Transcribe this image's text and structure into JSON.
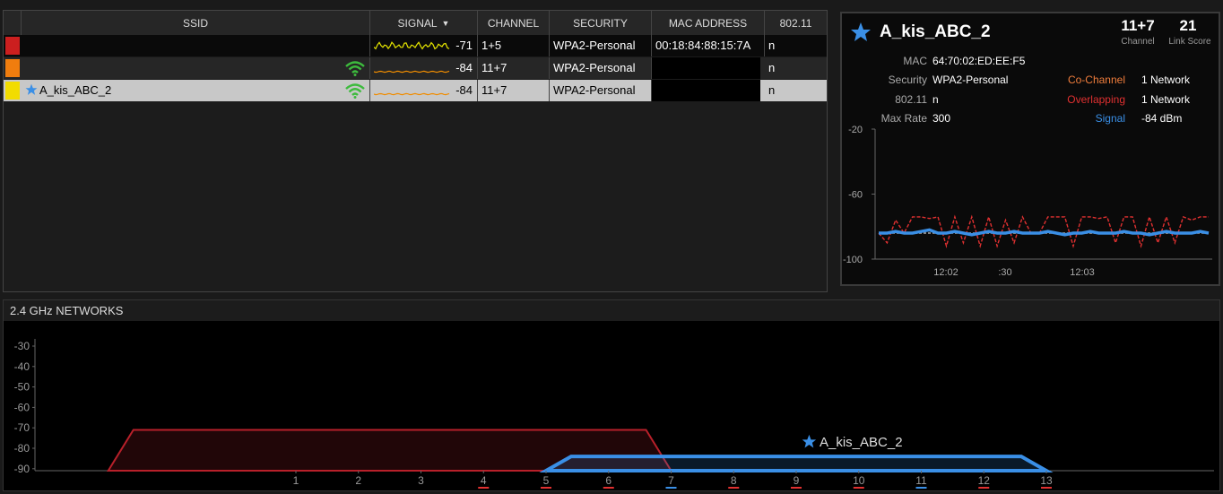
{
  "table": {
    "headers": [
      "SSID",
      "SIGNAL",
      "CHANNEL",
      "SECURITY",
      "MAC ADDRESS",
      "802.11"
    ],
    "rows": [
      {
        "color": "#cc1f1f",
        "ssid": "",
        "signal": "-71",
        "channel": "1+5",
        "security": "WPA2-Personal",
        "mac": "00:18:84:88:15:7A",
        "mode": "n",
        "spark_color": "#e6e600",
        "selected": false,
        "starred": false,
        "wifi_icon": false
      },
      {
        "color": "#f07d0e",
        "ssid": "",
        "signal": "-84",
        "channel": "11+7",
        "security": "WPA2-Personal",
        "mac": "",
        "mode": "n",
        "spark_color": "#f08c00",
        "selected": false,
        "starred": false,
        "wifi_icon": true
      },
      {
        "color": "#f2dc00",
        "ssid": "A_kis_ABC_2",
        "signal": "-84",
        "channel": "11+7",
        "security": "WPA2-Personal",
        "mac": "",
        "mode": "n",
        "spark_color": "#f08c00",
        "selected": true,
        "starred": true,
        "wifi_icon": true
      }
    ]
  },
  "detail": {
    "name": "A_kis_ABC_2",
    "channel_value": "11+7",
    "channel_label": "Channel",
    "link_score_value": "21",
    "link_score_label": "Link Score",
    "mac_label": "MAC",
    "mac_value": "64:70:02:ED:EE:F5",
    "security_label": "Security",
    "security_value": "WPA2-Personal",
    "mode_label": "802.11",
    "mode_value": "n",
    "maxrate_label": "Max Rate",
    "maxrate_value": "300",
    "cochannel_label": "Co-Channel",
    "cochannel_value": "1 Network",
    "overlapping_label": "Overlapping",
    "overlapping_value": "1 Network",
    "signal_label": "Signal",
    "signal_value": "-84 dBm",
    "colors": {
      "cochannel": "#f07d3c",
      "overlapping": "#e03030",
      "signal": "#3a8fe6"
    }
  },
  "chart_data": [
    {
      "type": "line",
      "title": "",
      "y_ticks": [
        "-20",
        "-60",
        "-100"
      ],
      "ylim": [
        -100,
        -20
      ],
      "x_ticks": [
        "12:02",
        ":30",
        "12:03"
      ],
      "series": [
        {
          "color": "#3a8fe6",
          "values": [
            -84,
            -84,
            -83,
            -84,
            -84,
            -83,
            -82,
            -84,
            -84,
            -83,
            -84,
            -85,
            -84,
            -83,
            -84,
            -84,
            -83,
            -84,
            -84,
            -84,
            -83,
            -84,
            -85,
            -84,
            -84,
            -83,
            -84,
            -84,
            -84,
            -83,
            -84,
            -84,
            -85,
            -84,
            -83,
            -84,
            -84,
            -84,
            -83,
            -84
          ]
        },
        {
          "color": "#e03030",
          "values": [
            -84,
            -90,
            -76,
            -84,
            -74,
            -74,
            -75,
            -74,
            -92,
            -74,
            -90,
            -74,
            -92,
            -74,
            -92,
            -76,
            -90,
            -74,
            -84,
            -84,
            -74,
            -74,
            -74,
            -92,
            -74,
            -74,
            -75,
            -74,
            -90,
            -74,
            -74,
            -92,
            -74,
            -90,
            -74,
            -90,
            -74,
            -76,
            -74,
            -74
          ]
        },
        {
          "color": "#aaaaaa",
          "values": [
            -84,
            -84,
            -84,
            -84,
            -84,
            -84,
            -84,
            -84,
            -84,
            -84,
            -84,
            -84,
            -84,
            -84,
            -84,
            -84,
            -84,
            -84,
            -84,
            -84,
            -84,
            -84,
            -84,
            -84,
            -84,
            -84,
            -84,
            -84,
            -84,
            -84,
            -84,
            -84,
            -84,
            -84,
            -84,
            -84,
            -84,
            -84,
            -84,
            -84
          ]
        }
      ]
    },
    {
      "type": "area",
      "title": "2.4 GHz NETWORKS",
      "y_ticks": [
        "-30",
        "-40",
        "-50",
        "-60",
        "-70",
        "-80",
        "-90"
      ],
      "ylim": [
        -92,
        -25
      ],
      "channels": [
        "1",
        "2",
        "3",
        "4",
        "5",
        "6",
        "7",
        "8",
        "9",
        "10",
        "11",
        "12",
        "13"
      ],
      "channel_underlines": {
        "4": "#e03030",
        "5": "#e03030",
        "6": "#e03030",
        "7": "#3a8fe6",
        "8": "#e03030",
        "9": "#e03030",
        "10": "#e03030",
        "11": "#3a8fe6",
        "12": "#e03030",
        "13": "#e03030"
      },
      "networks": [
        {
          "name": "",
          "color": "#b8202a",
          "start_channel": -2,
          "end_channel": 7,
          "level": -71
        },
        {
          "name": "A_kis_ABC_2",
          "color": "#3a8fe6",
          "start_channel": 5,
          "end_channel": 13,
          "level": -84,
          "starred": true
        }
      ]
    }
  ]
}
